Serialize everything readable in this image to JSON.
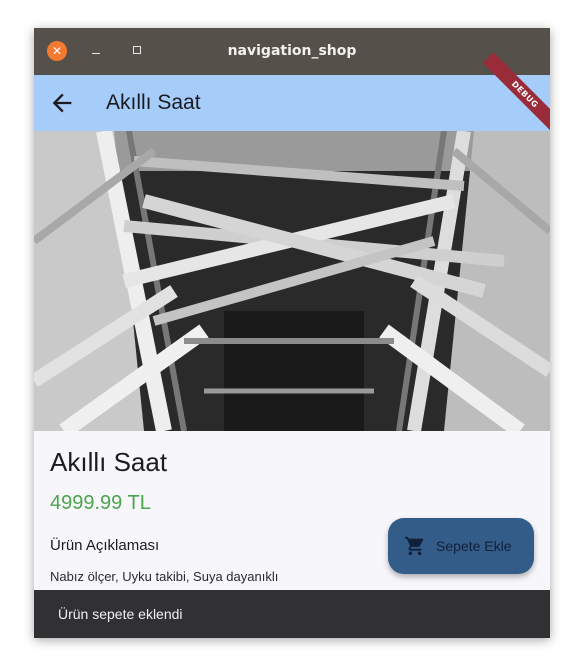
{
  "window": {
    "title": "navigation_shop",
    "close_icon": "close-icon",
    "minimize_icon": "minimize-icon",
    "maximize_icon": "maximize-icon"
  },
  "appbar": {
    "back_icon": "arrow-back-icon",
    "title": "Akıllı Saat",
    "debug_banner": "DEBUG",
    "background": "#a6ccfa"
  },
  "product": {
    "image": "steel-bridge-truss-photo",
    "name": "Akıllı Saat",
    "price": "4999.99 TL",
    "description_title": "Ürün Açıklaması",
    "description": "Nabız ölçer, Uyku takibi, Suya dayanıklı",
    "price_color": "#4aa54d"
  },
  "fab": {
    "icon": "shopping-cart-icon",
    "label": "Sepete Ekle",
    "color": "#335c88"
  },
  "snackbar": {
    "message": "Ürün sepete eklendi"
  }
}
